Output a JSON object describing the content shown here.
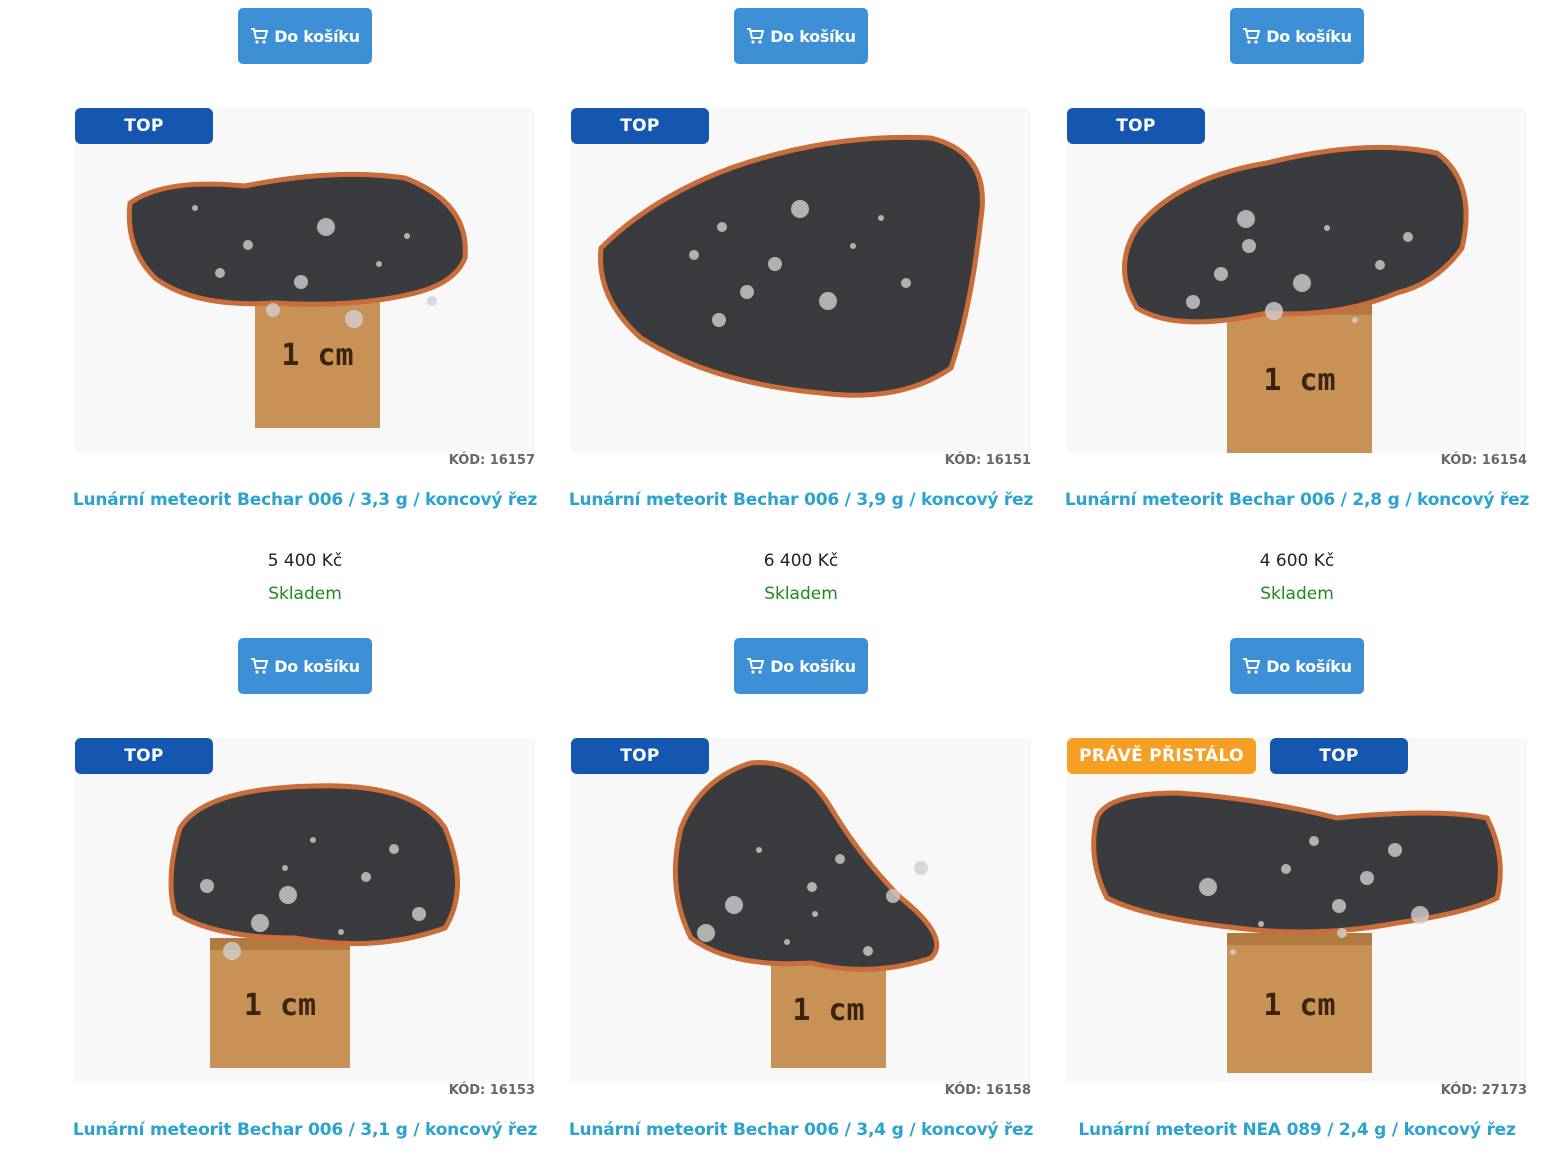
{
  "cart_label": "Do košíku",
  "colors": {
    "button": "#3d8fd6",
    "badge_top": "#1556b0",
    "badge_new": "#f5a025",
    "title": "#2aa3cf",
    "stock": "#1e8a1e"
  },
  "products": [
    {
      "badges": [
        "TOP"
      ],
      "code": "KÓD: 16157",
      "title": "Lunární meteorit Bechar 006 / 3,3 g / koncový řez",
      "price": "5 400 Kč",
      "stock": "Skladem",
      "scale_label": "1 cm"
    },
    {
      "badges": [
        "TOP"
      ],
      "code": "KÓD: 16151",
      "title": "Lunární meteorit Bechar 006 / 3,9 g / koncový řez",
      "price": "6 400 Kč",
      "stock": "Skladem",
      "scale_label": ""
    },
    {
      "badges": [
        "TOP"
      ],
      "code": "KÓD: 16154",
      "title": "Lunární meteorit Bechar 006 / 2,8 g / koncový řez",
      "price": "4 600 Kč",
      "stock": "Skladem",
      "scale_label": "1 cm"
    },
    {
      "badges": [
        "TOP"
      ],
      "code": "KÓD: 16153",
      "title": "Lunární meteorit Bechar 006 / 3,1 g / koncový řez",
      "scale_label": "1 cm"
    },
    {
      "badges": [
        "TOP"
      ],
      "code": "KÓD: 16158",
      "title": "Lunární meteorit Bechar 006 / 3,4 g / koncový řez",
      "scale_label": "1 cm"
    },
    {
      "badges": [
        "PRÁVĚ PŘISTÁLO",
        "TOP"
      ],
      "code": "KÓD: 27173",
      "title": "Lunární meteorit NEA 089 / 2,4 g / koncový řez",
      "scale_label": "1 cm"
    }
  ]
}
